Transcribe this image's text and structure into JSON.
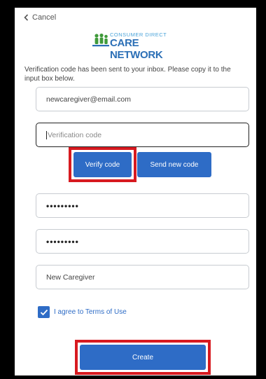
{
  "cancel_label": "Cancel",
  "logo": {
    "small_text": "CONSUMER DIRECT",
    "big_text": "CARE NETWORK"
  },
  "intro_text": "Verification code has been sent to your inbox. Please copy it to the input box below.",
  "email_value": "newcaregiver@email.com",
  "verification_placeholder": "Verification code",
  "verify_button": "Verify code",
  "send_new_button": "Send new code",
  "password_value": "•••••••••",
  "confirm_password_value": "•••••••••",
  "display_name_value": "New Caregiver",
  "terms_label": "I agree to Terms of Use",
  "terms_checked": true,
  "create_button": "Create",
  "colors": {
    "accent": "#2e6cc6",
    "highlight": "#d71a20",
    "logo_blue": "#2b6fb6"
  }
}
